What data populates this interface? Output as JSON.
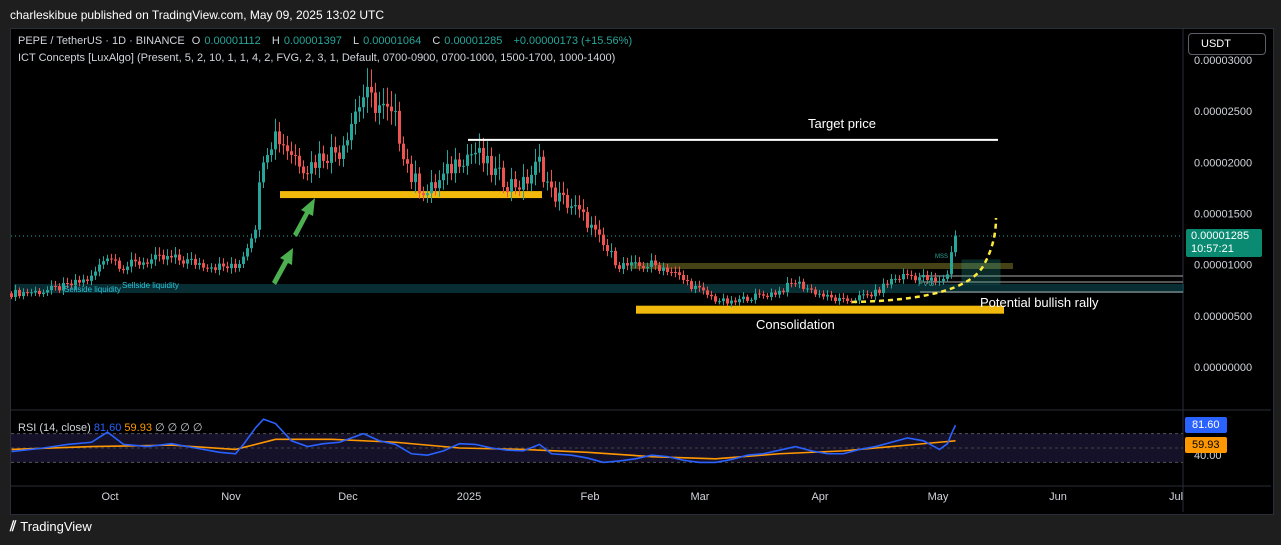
{
  "header": {
    "publisher": "charleskibue published on TradingView.com, May 09, 2025 13:02 UTC"
  },
  "legend": {
    "symbol": "PEPE / TetherUS · 1D · BINANCE",
    "open_label": "O",
    "open": "0.00001112",
    "high_label": "H",
    "high": "0.00001397",
    "low_label": "L",
    "low": "0.00001064",
    "close_label": "C",
    "close": "0.00001285",
    "change": "+0.00000173 (+15.56%)",
    "indicator": "ICT Concepts [LuxAlgo] (Present, 5, 2, 10, 1, 1, 4, 2, FVG, 2, 3, 1, Default, 0700-0900, 0700-1000, 1500-1700, 1000-1400)"
  },
  "currency_button": "USDT",
  "last_price": {
    "value": "0.00001285",
    "countdown": "10:57:21"
  },
  "rsi": {
    "label": "RSI (14, close)",
    "value": "81.60",
    "ma": "59.93",
    "extra": "∅ ∅ ∅ ∅",
    "axis_tick": "40.00",
    "line_color": "#2962ff",
    "ma_color": "#ff9800"
  },
  "annotations": {
    "target": "Target price",
    "rally": "Potential bullish rally",
    "consolidation": "Consolidation",
    "sellside1": "Sellside liquidity",
    "sellside2": "Sellside liquidity",
    "mss": "MSS",
    "fvg": "FVG"
  },
  "footer": {
    "brand": "TradingView"
  },
  "colors": {
    "up": "#26a69a",
    "down": "#ef5350",
    "zone": "#f0b90b",
    "rally_curve": "#ffeb3b",
    "arrow": "#4caf50",
    "background": "#000000"
  },
  "chart_data": {
    "type": "candlestick",
    "title": "PEPE / TetherUS · 1D · BINANCE",
    "y_tick_labels": [
      "0.00003000",
      "0.00002500",
      "0.00002000",
      "0.00001500",
      "0.00001000",
      "0.00000500",
      "0.00000000"
    ],
    "y_ticks": [
      3e-05,
      2.5e-05,
      2e-05,
      1.5e-05,
      1e-05,
      5e-06,
      0
    ],
    "ylim": [
      0,
      3.05e-05
    ],
    "x_tick_labels": [
      "Oct",
      "Nov",
      "Dec",
      "2025",
      "Feb",
      "Mar",
      "Apr",
      "May",
      "Jun",
      "Jul"
    ],
    "last_close": 1.285e-05,
    "levels": {
      "target_price": 2.22e-05,
      "resistance_zone": 1.68e-05,
      "consolidation_zone": 5.6e-06
    },
    "close_path": [
      {
        "i": 0,
        "c": 7.2e-06
      },
      {
        "i": 8,
        "c": 7.4e-06
      },
      {
        "i": 14,
        "c": 7.9e-06
      },
      {
        "i": 20,
        "c": 8.7e-06
      },
      {
        "i": 24,
        "c": 1.1e-05
      },
      {
        "i": 28,
        "c": 9.8e-06
      },
      {
        "i": 34,
        "c": 1.04e-05
      },
      {
        "i": 40,
        "c": 1.06e-05
      },
      {
        "i": 46,
        "c": 1.02e-05
      },
      {
        "i": 52,
        "c": 9.8e-06
      },
      {
        "i": 56,
        "c": 9.7e-06
      },
      {
        "i": 58,
        "c": 1.1e-05
      },
      {
        "i": 61,
        "c": 1.4e-05
      },
      {
        "i": 63,
        "c": 2.1e-05
      },
      {
        "i": 66,
        "c": 2.28e-05
      },
      {
        "i": 70,
        "c": 2.1e-05
      },
      {
        "i": 74,
        "c": 1.95e-05
      },
      {
        "i": 78,
        "c": 2.08e-05
      },
      {
        "i": 82,
        "c": 2.12e-05
      },
      {
        "i": 86,
        "c": 2.5e-05
      },
      {
        "i": 88,
        "c": 2.65e-05
      },
      {
        "i": 92,
        "c": 2.55e-05
      },
      {
        "i": 96,
        "c": 2.4e-05
      },
      {
        "i": 100,
        "c": 1.85e-05
      },
      {
        "i": 104,
        "c": 1.7e-05
      },
      {
        "i": 108,
        "c": 1.85e-05
      },
      {
        "i": 112,
        "c": 2.05e-05
      },
      {
        "i": 116,
        "c": 2.1e-05
      },
      {
        "i": 120,
        "c": 1.92e-05
      },
      {
        "i": 124,
        "c": 1.8e-05
      },
      {
        "i": 128,
        "c": 1.78e-05
      },
      {
        "i": 132,
        "c": 2e-05
      },
      {
        "i": 135,
        "c": 1.7e-05
      },
      {
        "i": 140,
        "c": 1.58e-05
      },
      {
        "i": 144,
        "c": 1.42e-05
      },
      {
        "i": 148,
        "c": 1.18e-05
      },
      {
        "i": 152,
        "c": 1e-05
      },
      {
        "i": 156,
        "c": 9.8e-06
      },
      {
        "i": 160,
        "c": 1e-05
      },
      {
        "i": 164,
        "c": 9.6e-06
      },
      {
        "i": 168,
        "c": 8.5e-06
      },
      {
        "i": 172,
        "c": 7.5e-06
      },
      {
        "i": 176,
        "c": 6.6e-06
      },
      {
        "i": 180,
        "c": 6.2e-06
      },
      {
        "i": 184,
        "c": 6.8e-06
      },
      {
        "i": 188,
        "c": 7e-06
      },
      {
        "i": 192,
        "c": 7.4e-06
      },
      {
        "i": 196,
        "c": 8.3e-06
      },
      {
        "i": 200,
        "c": 7.5e-06
      },
      {
        "i": 204,
        "c": 6.8e-06
      },
      {
        "i": 208,
        "c": 6.4e-06
      },
      {
        "i": 212,
        "c": 6.8e-06
      },
      {
        "i": 216,
        "c": 7.2e-06
      },
      {
        "i": 220,
        "c": 8.5e-06
      },
      {
        "i": 224,
        "c": 9e-06
      },
      {
        "i": 228,
        "c": 8.7e-06
      },
      {
        "i": 232,
        "c": 8.2e-06
      },
      {
        "i": 234,
        "c": 9.2e-06
      },
      {
        "i": 235,
        "c": 1.11e-05
      },
      {
        "i": 236,
        "c": 1.285e-05
      }
    ],
    "rsi_series": [
      {
        "i": 0,
        "v": 45
      },
      {
        "i": 8,
        "v": 50
      },
      {
        "i": 14,
        "v": 55
      },
      {
        "i": 20,
        "v": 58
      },
      {
        "i": 24,
        "v": 72
      },
      {
        "i": 28,
        "v": 55
      },
      {
        "i": 34,
        "v": 52
      },
      {
        "i": 40,
        "v": 56
      },
      {
        "i": 46,
        "v": 50
      },
      {
        "i": 52,
        "v": 44
      },
      {
        "i": 56,
        "v": 42
      },
      {
        "i": 58,
        "v": 55
      },
      {
        "i": 61,
        "v": 78
      },
      {
        "i": 63,
        "v": 90
      },
      {
        "i": 66,
        "v": 84
      },
      {
        "i": 70,
        "v": 60
      },
      {
        "i": 74,
        "v": 52
      },
      {
        "i": 78,
        "v": 56
      },
      {
        "i": 82,
        "v": 58
      },
      {
        "i": 86,
        "v": 66
      },
      {
        "i": 88,
        "v": 70
      },
      {
        "i": 92,
        "v": 60
      },
      {
        "i": 96,
        "v": 55
      },
      {
        "i": 100,
        "v": 42
      },
      {
        "i": 104,
        "v": 40
      },
      {
        "i": 108,
        "v": 46
      },
      {
        "i": 112,
        "v": 56
      },
      {
        "i": 116,
        "v": 55
      },
      {
        "i": 120,
        "v": 50
      },
      {
        "i": 124,
        "v": 47
      },
      {
        "i": 128,
        "v": 46
      },
      {
        "i": 132,
        "v": 55
      },
      {
        "i": 135,
        "v": 42
      },
      {
        "i": 140,
        "v": 40
      },
      {
        "i": 144,
        "v": 36
      },
      {
        "i": 148,
        "v": 30
      },
      {
        "i": 152,
        "v": 32
      },
      {
        "i": 156,
        "v": 35
      },
      {
        "i": 160,
        "v": 40
      },
      {
        "i": 164,
        "v": 38
      },
      {
        "i": 168,
        "v": 33
      },
      {
        "i": 172,
        "v": 30
      },
      {
        "i": 176,
        "v": 30
      },
      {
        "i": 180,
        "v": 34
      },
      {
        "i": 184,
        "v": 40
      },
      {
        "i": 188,
        "v": 42
      },
      {
        "i": 192,
        "v": 47
      },
      {
        "i": 196,
        "v": 52
      },
      {
        "i": 200,
        "v": 46
      },
      {
        "i": 204,
        "v": 42
      },
      {
        "i": 208,
        "v": 42
      },
      {
        "i": 212,
        "v": 48
      },
      {
        "i": 216,
        "v": 52
      },
      {
        "i": 220,
        "v": 58
      },
      {
        "i": 224,
        "v": 64
      },
      {
        "i": 228,
        "v": 60
      },
      {
        "i": 232,
        "v": 48
      },
      {
        "i": 234,
        "v": 56
      },
      {
        "i": 235,
        "v": 70
      },
      {
        "i": 236,
        "v": 81.6
      }
    ],
    "rsi_ma_series": [
      {
        "i": 0,
        "v": 48
      },
      {
        "i": 20,
        "v": 52
      },
      {
        "i": 40,
        "v": 54
      },
      {
        "i": 56,
        "v": 48
      },
      {
        "i": 66,
        "v": 62
      },
      {
        "i": 80,
        "v": 62
      },
      {
        "i": 96,
        "v": 58
      },
      {
        "i": 112,
        "v": 50
      },
      {
        "i": 128,
        "v": 48
      },
      {
        "i": 144,
        "v": 44
      },
      {
        "i": 160,
        "v": 38
      },
      {
        "i": 176,
        "v": 35
      },
      {
        "i": 192,
        "v": 42
      },
      {
        "i": 208,
        "v": 46
      },
      {
        "i": 224,
        "v": 54
      },
      {
        "i": 232,
        "v": 58
      },
      {
        "i": 236,
        "v": 59.93
      }
    ]
  }
}
